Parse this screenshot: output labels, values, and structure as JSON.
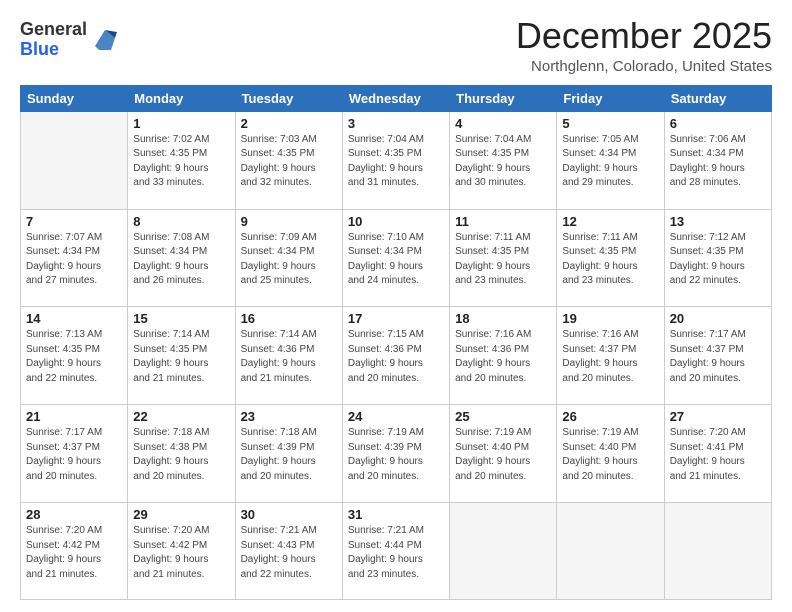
{
  "logo": {
    "general": "General",
    "blue": "Blue"
  },
  "header": {
    "month": "December 2025",
    "location": "Northglenn, Colorado, United States"
  },
  "weekdays": [
    "Sunday",
    "Monday",
    "Tuesday",
    "Wednesday",
    "Thursday",
    "Friday",
    "Saturday"
  ],
  "weeks": [
    [
      {
        "day": "",
        "empty": true
      },
      {
        "day": "1",
        "sunrise": "7:02 AM",
        "sunset": "4:35 PM",
        "daylight": "9 hours and 33 minutes."
      },
      {
        "day": "2",
        "sunrise": "7:03 AM",
        "sunset": "4:35 PM",
        "daylight": "9 hours and 32 minutes."
      },
      {
        "day": "3",
        "sunrise": "7:04 AM",
        "sunset": "4:35 PM",
        "daylight": "9 hours and 31 minutes."
      },
      {
        "day": "4",
        "sunrise": "7:04 AM",
        "sunset": "4:35 PM",
        "daylight": "9 hours and 30 minutes."
      },
      {
        "day": "5",
        "sunrise": "7:05 AM",
        "sunset": "4:34 PM",
        "daylight": "9 hours and 29 minutes."
      },
      {
        "day": "6",
        "sunrise": "7:06 AM",
        "sunset": "4:34 PM",
        "daylight": "9 hours and 28 minutes."
      }
    ],
    [
      {
        "day": "7",
        "sunrise": "7:07 AM",
        "sunset": "4:34 PM",
        "daylight": "9 hours and 27 minutes."
      },
      {
        "day": "8",
        "sunrise": "7:08 AM",
        "sunset": "4:34 PM",
        "daylight": "9 hours and 26 minutes."
      },
      {
        "day": "9",
        "sunrise": "7:09 AM",
        "sunset": "4:34 PM",
        "daylight": "9 hours and 25 minutes."
      },
      {
        "day": "10",
        "sunrise": "7:10 AM",
        "sunset": "4:34 PM",
        "daylight": "9 hours and 24 minutes."
      },
      {
        "day": "11",
        "sunrise": "7:11 AM",
        "sunset": "4:35 PM",
        "daylight": "9 hours and 23 minutes."
      },
      {
        "day": "12",
        "sunrise": "7:11 AM",
        "sunset": "4:35 PM",
        "daylight": "9 hours and 23 minutes."
      },
      {
        "day": "13",
        "sunrise": "7:12 AM",
        "sunset": "4:35 PM",
        "daylight": "9 hours and 22 minutes."
      }
    ],
    [
      {
        "day": "14",
        "sunrise": "7:13 AM",
        "sunset": "4:35 PM",
        "daylight": "9 hours and 22 minutes."
      },
      {
        "day": "15",
        "sunrise": "7:14 AM",
        "sunset": "4:35 PM",
        "daylight": "9 hours and 21 minutes."
      },
      {
        "day": "16",
        "sunrise": "7:14 AM",
        "sunset": "4:36 PM",
        "daylight": "9 hours and 21 minutes."
      },
      {
        "day": "17",
        "sunrise": "7:15 AM",
        "sunset": "4:36 PM",
        "daylight": "9 hours and 20 minutes."
      },
      {
        "day": "18",
        "sunrise": "7:16 AM",
        "sunset": "4:36 PM",
        "daylight": "9 hours and 20 minutes."
      },
      {
        "day": "19",
        "sunrise": "7:16 AM",
        "sunset": "4:37 PM",
        "daylight": "9 hours and 20 minutes."
      },
      {
        "day": "20",
        "sunrise": "7:17 AM",
        "sunset": "4:37 PM",
        "daylight": "9 hours and 20 minutes."
      }
    ],
    [
      {
        "day": "21",
        "sunrise": "7:17 AM",
        "sunset": "4:37 PM",
        "daylight": "9 hours and 20 minutes."
      },
      {
        "day": "22",
        "sunrise": "7:18 AM",
        "sunset": "4:38 PM",
        "daylight": "9 hours and 20 minutes."
      },
      {
        "day": "23",
        "sunrise": "7:18 AM",
        "sunset": "4:39 PM",
        "daylight": "9 hours and 20 minutes."
      },
      {
        "day": "24",
        "sunrise": "7:19 AM",
        "sunset": "4:39 PM",
        "daylight": "9 hours and 20 minutes."
      },
      {
        "day": "25",
        "sunrise": "7:19 AM",
        "sunset": "4:40 PM",
        "daylight": "9 hours and 20 minutes."
      },
      {
        "day": "26",
        "sunrise": "7:19 AM",
        "sunset": "4:40 PM",
        "daylight": "9 hours and 20 minutes."
      },
      {
        "day": "27",
        "sunrise": "7:20 AM",
        "sunset": "4:41 PM",
        "daylight": "9 hours and 21 minutes."
      }
    ],
    [
      {
        "day": "28",
        "sunrise": "7:20 AM",
        "sunset": "4:42 PM",
        "daylight": "9 hours and 21 minutes."
      },
      {
        "day": "29",
        "sunrise": "7:20 AM",
        "sunset": "4:42 PM",
        "daylight": "9 hours and 21 minutes."
      },
      {
        "day": "30",
        "sunrise": "7:21 AM",
        "sunset": "4:43 PM",
        "daylight": "9 hours and 22 minutes."
      },
      {
        "day": "31",
        "sunrise": "7:21 AM",
        "sunset": "4:44 PM",
        "daylight": "9 hours and 23 minutes."
      },
      {
        "day": "",
        "empty": true
      },
      {
        "day": "",
        "empty": true
      },
      {
        "day": "",
        "empty": true
      }
    ]
  ]
}
